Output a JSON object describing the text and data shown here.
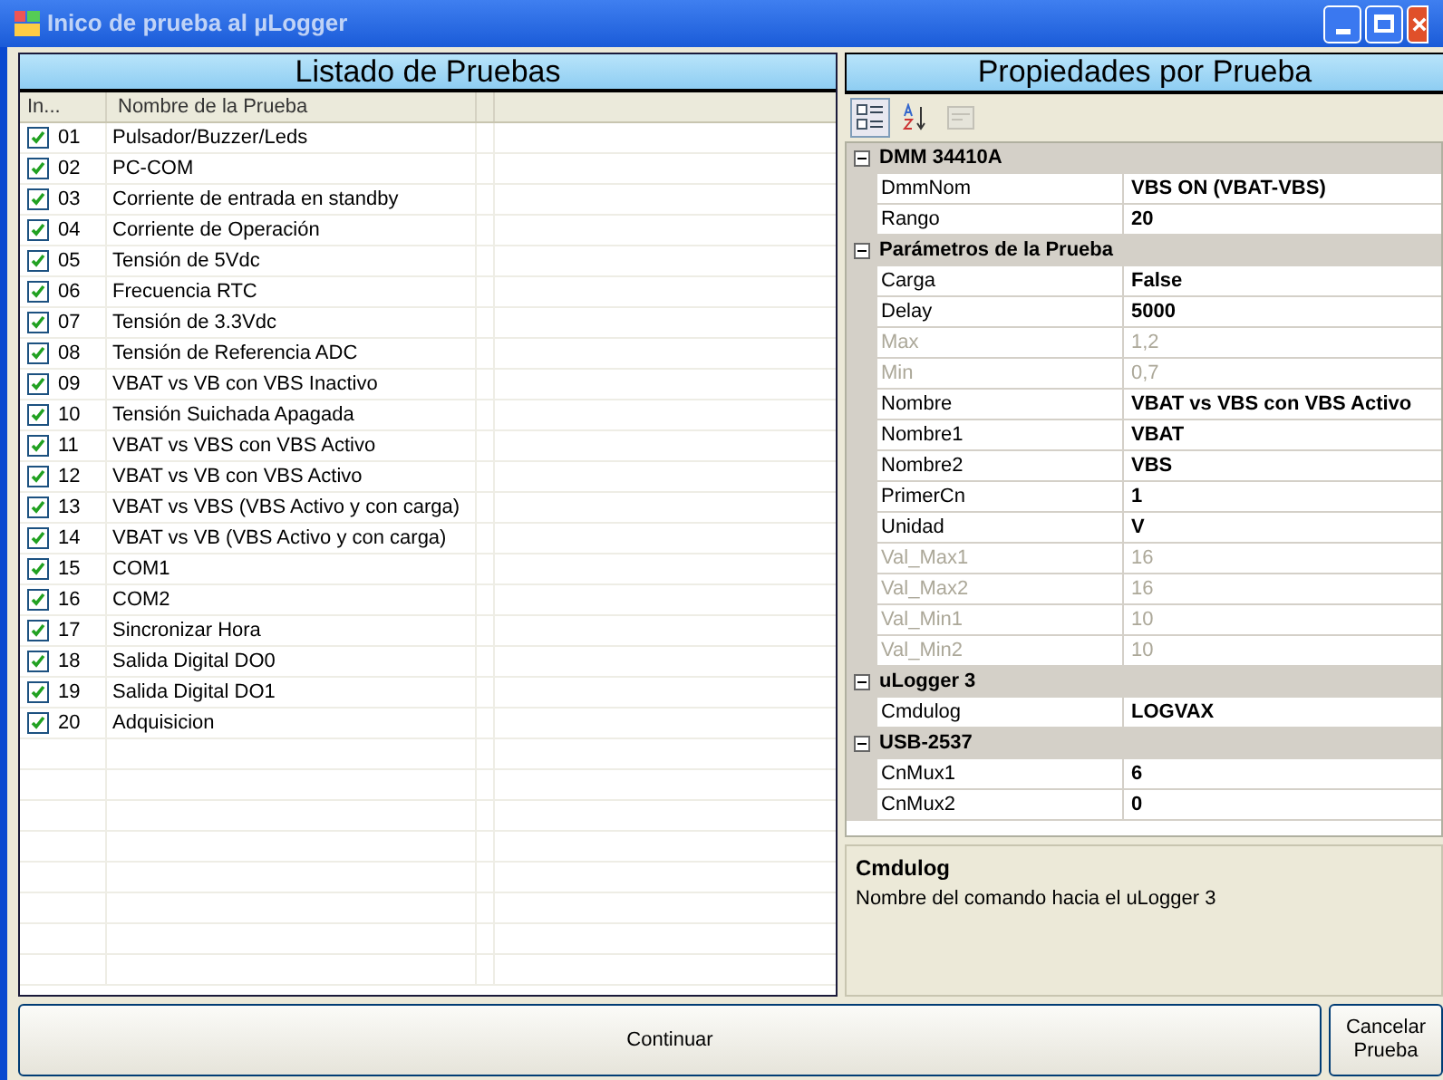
{
  "window": {
    "title": "Inico de prueba al µLogger"
  },
  "tests": {
    "title": "Listado de Pruebas",
    "columns": [
      "In...",
      "Nombre de la Prueba"
    ],
    "rows": [
      {
        "checked": true,
        "number": "01",
        "name": "Pulsador/Buzzer/Leds"
      },
      {
        "checked": true,
        "number": "02",
        "name": "PC-COM"
      },
      {
        "checked": true,
        "number": "03",
        "name": "Corriente de entrada en standby"
      },
      {
        "checked": true,
        "number": "04",
        "name": "Corriente de Operación"
      },
      {
        "checked": true,
        "number": "05",
        "name": "Tensión de 5Vdc"
      },
      {
        "checked": true,
        "number": "06",
        "name": "Frecuencia RTC"
      },
      {
        "checked": true,
        "number": "07",
        "name": "Tensión de 3.3Vdc"
      },
      {
        "checked": true,
        "number": "08",
        "name": "Tensión de Referencia ADC"
      },
      {
        "checked": true,
        "number": "09",
        "name": "VBAT vs VB con VBS Inactivo"
      },
      {
        "checked": true,
        "number": "10",
        "name": "Tensión Suichada Apagada"
      },
      {
        "checked": true,
        "number": "11",
        "name": "VBAT vs VBS con VBS Activo"
      },
      {
        "checked": true,
        "number": "12",
        "name": "VBAT vs VB con VBS Activo"
      },
      {
        "checked": true,
        "number": "13",
        "name": "VBAT vs VBS (VBS Activo y con carga)"
      },
      {
        "checked": true,
        "number": "14",
        "name": "VBAT vs VB (VBS Activo y con carga)"
      },
      {
        "checked": true,
        "number": "15",
        "name": "COM1"
      },
      {
        "checked": true,
        "number": "16",
        "name": "COM2"
      },
      {
        "checked": true,
        "number": "17",
        "name": "Sincronizar Hora"
      },
      {
        "checked": true,
        "number": "18",
        "name": "Salida Digital DO0"
      },
      {
        "checked": true,
        "number": "19",
        "name": "Salida Digital DO1"
      },
      {
        "checked": true,
        "number": "20",
        "name": "Adquisicion"
      }
    ]
  },
  "properties": {
    "title": "Propiedades por Prueba",
    "toolbar": [
      {
        "kind": "categorized",
        "selected": true,
        "disabled": false
      },
      {
        "kind": "alphabetical",
        "selected": false,
        "disabled": false
      },
      {
        "kind": "pages",
        "selected": false,
        "disabled": true
      }
    ],
    "categories": [
      {
        "name": "DMM 34410A",
        "expanded": true,
        "items": [
          {
            "name": "DmmNom",
            "value": "VBS ON (VBAT-VBS)",
            "disabled": false
          },
          {
            "name": "Rango",
            "value": "20",
            "disabled": false
          }
        ]
      },
      {
        "name": "Parámetros de la Prueba",
        "expanded": true,
        "items": [
          {
            "name": "Carga",
            "value": "False",
            "disabled": false
          },
          {
            "name": "Delay",
            "value": "5000",
            "disabled": false
          },
          {
            "name": "Max",
            "value": "1,2",
            "disabled": true
          },
          {
            "name": "Min",
            "value": "0,7",
            "disabled": true
          },
          {
            "name": "Nombre",
            "value": "VBAT vs VBS con VBS Activo",
            "disabled": false
          },
          {
            "name": "Nombre1",
            "value": "VBAT",
            "disabled": false
          },
          {
            "name": "Nombre2",
            "value": "VBS",
            "disabled": false
          },
          {
            "name": "PrimerCn",
            "value": "1",
            "disabled": false
          },
          {
            "name": "Unidad",
            "value": "V",
            "disabled": false
          },
          {
            "name": "Val_Max1",
            "value": "16",
            "disabled": true
          },
          {
            "name": "Val_Max2",
            "value": "16",
            "disabled": true
          },
          {
            "name": "Val_Min1",
            "value": "10",
            "disabled": true
          },
          {
            "name": "Val_Min2",
            "value": "10",
            "disabled": true
          }
        ]
      },
      {
        "name": "uLogger 3",
        "expanded": true,
        "items": [
          {
            "name": "Cmdulog",
            "value": "LOGVAX",
            "disabled": false
          }
        ]
      },
      {
        "name": "USB-2537",
        "expanded": true,
        "items": [
          {
            "name": "CnMux1",
            "value": "6",
            "disabled": false
          },
          {
            "name": "CnMux2",
            "value": "0",
            "disabled": false
          }
        ]
      }
    ],
    "description": {
      "title": "Cmdulog",
      "text": "Nombre del comando hacia el uLogger 3"
    }
  },
  "buttons": [
    "Continuar",
    "Cancelar Prueba"
  ]
}
